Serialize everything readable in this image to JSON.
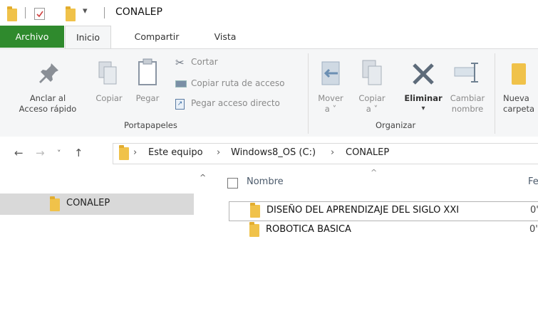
{
  "window": {
    "title": "CONALEP"
  },
  "quick_access": {
    "save_icon": "checklist-icon"
  },
  "tabs": [
    "Archivo",
    "Inicio",
    "Compartir",
    "Vista"
  ],
  "ribbon": {
    "pin": {
      "line1": "Anclar al",
      "line2": "Acceso rápido"
    },
    "copy": "Copiar",
    "paste": "Pegar",
    "cut": "Cortar",
    "copy_path": "Copiar ruta de acceso",
    "paste_shortcut": "Pegar acceso directo",
    "group_clipboard": "Portapapeles",
    "move": {
      "line1": "Mover",
      "line2": "a ˅"
    },
    "copy_to": {
      "line1": "Copiar",
      "line2": "a ˅"
    },
    "delete": "Eliminar",
    "rename": {
      "line1": "Cambiar",
      "line2": "nombre"
    },
    "group_organize": "Organizar",
    "new_folder": {
      "line1": "Nueva",
      "line2": "carpeta"
    }
  },
  "address": {
    "crumbs": [
      "Este equipo",
      "Windows8_OS (C:)",
      "CONALEP"
    ]
  },
  "nav": {
    "selected": "CONALEP"
  },
  "list": {
    "col_name": "Nombre",
    "col_date_partial": "Fe",
    "rows": [
      {
        "name": "DISEÑO DEL APRENDIZAJE DEL SIGLO XXI",
        "date_partial": "0'"
      },
      {
        "name": "ROBOTICA BASICA",
        "date_partial": "0'"
      }
    ]
  },
  "colors": {
    "file_tab": "#2f8a2d",
    "folder": "#f0c24a",
    "selection": "#d9d9d9"
  }
}
